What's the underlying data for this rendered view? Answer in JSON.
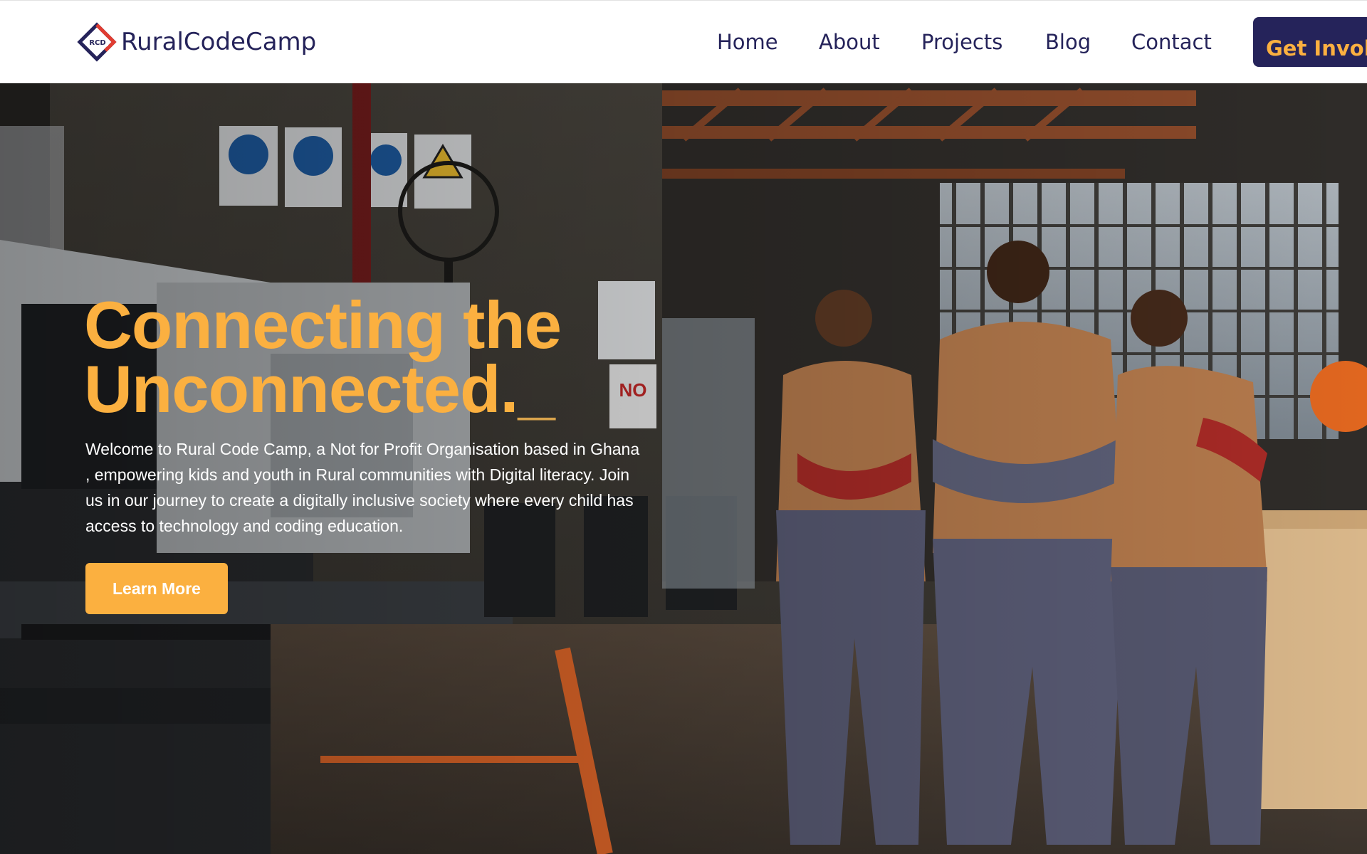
{
  "header": {
    "brand": "RuralCodeCamp",
    "logo_mark_text": "RCD",
    "nav": [
      {
        "label": "Home"
      },
      {
        "label": "About"
      },
      {
        "label": "Projects"
      },
      {
        "label": "Blog"
      },
      {
        "label": "Contact"
      }
    ],
    "cta_label": "Get Involved"
  },
  "hero": {
    "title_line1": "Connecting the",
    "title_line2": "Unconnected.",
    "title_cursor": "_",
    "description": "Welcome to Rural Code Camp, a Not for Profit Organisation based in Ghana , empowering kids and youth in Rural communities with Digital literacy. Join us in our journey to create a digitally inclusive society where every child has access to technology and coding education.",
    "button_label": "Learn More",
    "photo_subject": "workshop-team-photo"
  },
  "colors": {
    "brand_navy": "#25235a",
    "accent_orange": "#fbb040",
    "logo_red": "#e03c31",
    "hero_text": "#ffffff"
  },
  "icons": {
    "logo": "rcd-diamond-logo-icon"
  }
}
